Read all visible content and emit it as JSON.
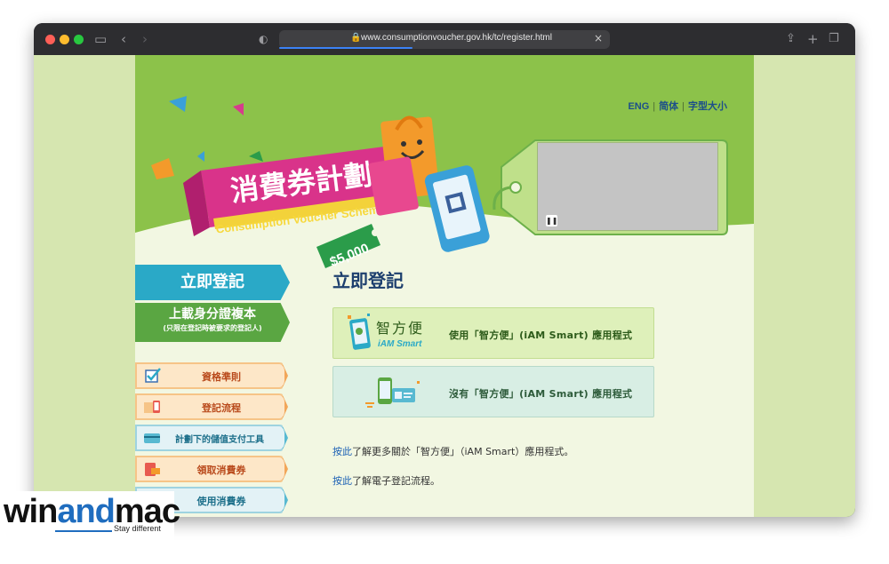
{
  "browser": {
    "url": "www.consumptionvoucher.gov.hk/tc/register.html"
  },
  "banner": {
    "title_zh": "消費券計劃",
    "title_en": "Consumption Voucher Scheme",
    "amount": "$5,000",
    "lang_links": [
      "ENG",
      "简体",
      "字型大小"
    ]
  },
  "sidebar": {
    "register": "立即登記",
    "upload": "上載身分證複本",
    "upload_note": "(只限在登記時被要求的登記人)",
    "items": [
      {
        "label": "資格準則",
        "icon": "checkmark-icon"
      },
      {
        "label": "登記流程",
        "icon": "phone-form-icon"
      },
      {
        "label": "計劃下的儲值支付工具",
        "icon": "payment-card-icon"
      },
      {
        "label": "領取消費券",
        "icon": "voucher-icon"
      },
      {
        "label": "使用消費券",
        "icon": "shopping-icon"
      }
    ]
  },
  "main": {
    "title": "立即登記",
    "iam_logo_zh": "智方便",
    "iam_logo_en": "iAM Smart",
    "option1": "使用「智方便」(iAM Smart) 應用程式",
    "option2": "沒有「智方便」(iAM Smart) 應用程式",
    "para1_link": "按此",
    "para1_text": "了解更多關於「智方便」（iAM Smart）應用程式。",
    "para2_link": "按此",
    "para2_text": "了解電子登記流程。"
  },
  "watermark": {
    "part1": "win",
    "part2": "and",
    "part3": "mac",
    "tagline": "Stay different"
  },
  "colors": {
    "banner_green": "#8cc24a",
    "register_blue": "#2aa9c7",
    "upload_green": "#5aa642",
    "title_navy": "#1d3f6e",
    "link_blue": "#1a5fb4"
  }
}
